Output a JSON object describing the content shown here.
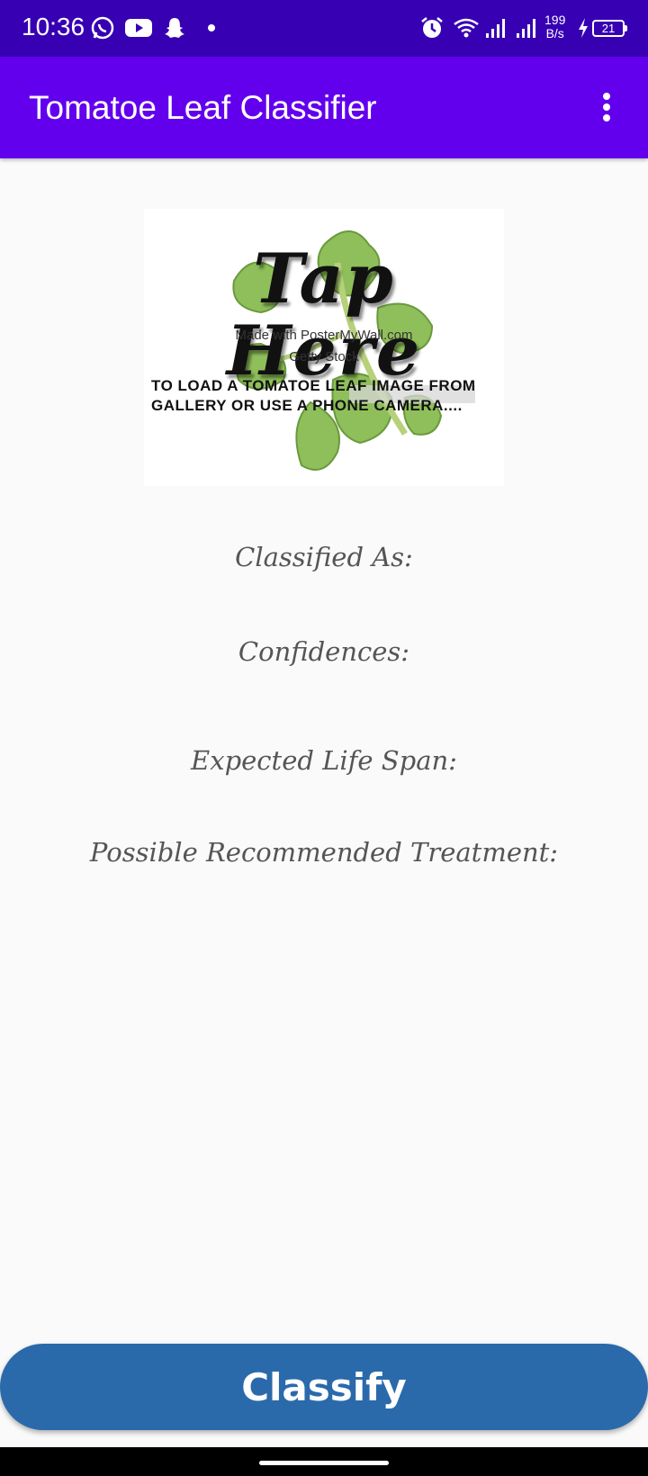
{
  "status_bar": {
    "time": "10:36",
    "net_speed_value": "199",
    "net_speed_unit": "B/s",
    "battery": "21",
    "icons": [
      "whatsapp-icon",
      "youtube-icon",
      "snapchat-icon",
      "notification-dot-icon",
      "alarm-icon",
      "wifi-icon",
      "signal-icon",
      "signal-icon-2",
      "charging-icon"
    ]
  },
  "app_bar": {
    "title": "Tomatoe Leaf Classifier",
    "menu_icon": "more-vert-icon"
  },
  "image": {
    "headline": "Tap Here",
    "watermark_line1": "Made with PosterMyWall.com",
    "watermark_line2": "Getty Stock",
    "caption_line1": "TO LOAD A TOMATOE  LEAF IMAGE FROM",
    "caption_line2": "GALLERY OR USE A PHONE CAMERA...."
  },
  "results": {
    "classified_label": "Classified As:",
    "confidences_label": "Confidences:",
    "lifespan_label": "Expected Life Span:",
    "treatment_label": "Possible Recommended Treatment:"
  },
  "classify_button": {
    "label": "Classify"
  },
  "colors": {
    "status_bar": "#3700b3",
    "app_bar": "#6200ee",
    "button": "#2a6aab",
    "background": "#fafafa"
  }
}
